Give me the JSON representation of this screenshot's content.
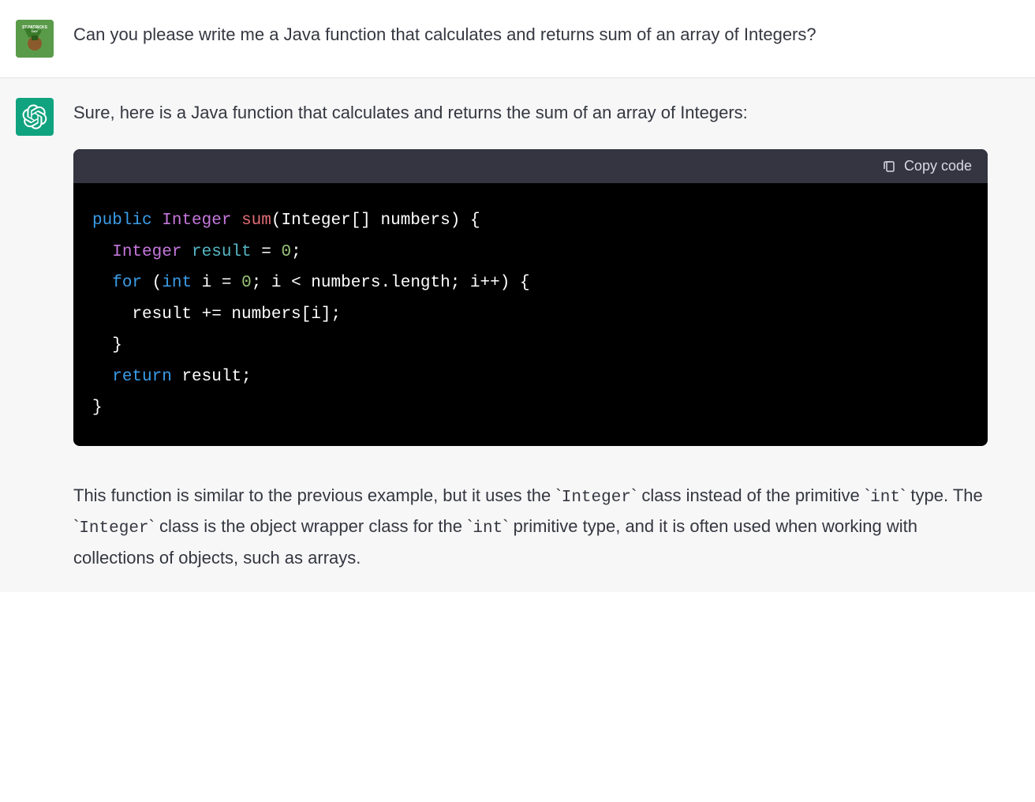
{
  "user_message": "Can you please write me a Java function that calculates and returns sum of an array of Integers?",
  "assistant_intro": "Sure, here is a Java function that calculates and returns the sum of an array of Integers:",
  "copy_label": "Copy code",
  "code": {
    "tokens": [
      {
        "cls": "tok-keyword",
        "text": "public"
      },
      {
        "cls": "tok-default",
        "text": " "
      },
      {
        "cls": "tok-type",
        "text": "Integer"
      },
      {
        "cls": "tok-default",
        "text": " "
      },
      {
        "cls": "tok-func",
        "text": "sum"
      },
      {
        "cls": "tok-default",
        "text": "("
      },
      {
        "cls": "tok-default",
        "text": "Integer[] numbers"
      },
      {
        "cls": "tok-default",
        "text": ") {\n  "
      },
      {
        "cls": "tok-type",
        "text": "Integer"
      },
      {
        "cls": "tok-default",
        "text": " "
      },
      {
        "cls": "tok-var",
        "text": "result"
      },
      {
        "cls": "tok-default",
        "text": " = "
      },
      {
        "cls": "tok-num",
        "text": "0"
      },
      {
        "cls": "tok-default",
        "text": ";\n  "
      },
      {
        "cls": "tok-keyword",
        "text": "for"
      },
      {
        "cls": "tok-default",
        "text": " ("
      },
      {
        "cls": "tok-keyword",
        "text": "int"
      },
      {
        "cls": "tok-default",
        "text": " i = "
      },
      {
        "cls": "tok-num",
        "text": "0"
      },
      {
        "cls": "tok-default",
        "text": "; i < numbers.length; i++) {\n    result += numbers[i];\n  }\n  "
      },
      {
        "cls": "tok-keyword",
        "text": "return"
      },
      {
        "cls": "tok-default",
        "text": " result;\n}"
      }
    ]
  },
  "explanation_parts": [
    {
      "type": "text",
      "text": "This function is similar to the previous example, but it uses the `"
    },
    {
      "type": "code",
      "text": "Integer"
    },
    {
      "type": "text",
      "text": "` class instead of the primitive `"
    },
    {
      "type": "code",
      "text": "int"
    },
    {
      "type": "text",
      "text": "` type. The `"
    },
    {
      "type": "code",
      "text": "Integer"
    },
    {
      "type": "text",
      "text": "` class is the object wrapper class for the `"
    },
    {
      "type": "code",
      "text": "int"
    },
    {
      "type": "text",
      "text": "` primitive type, and it is often used when working with collections of objects, such as arrays."
    }
  ],
  "avatar_user_label": "ST.PATRICKS DAY"
}
